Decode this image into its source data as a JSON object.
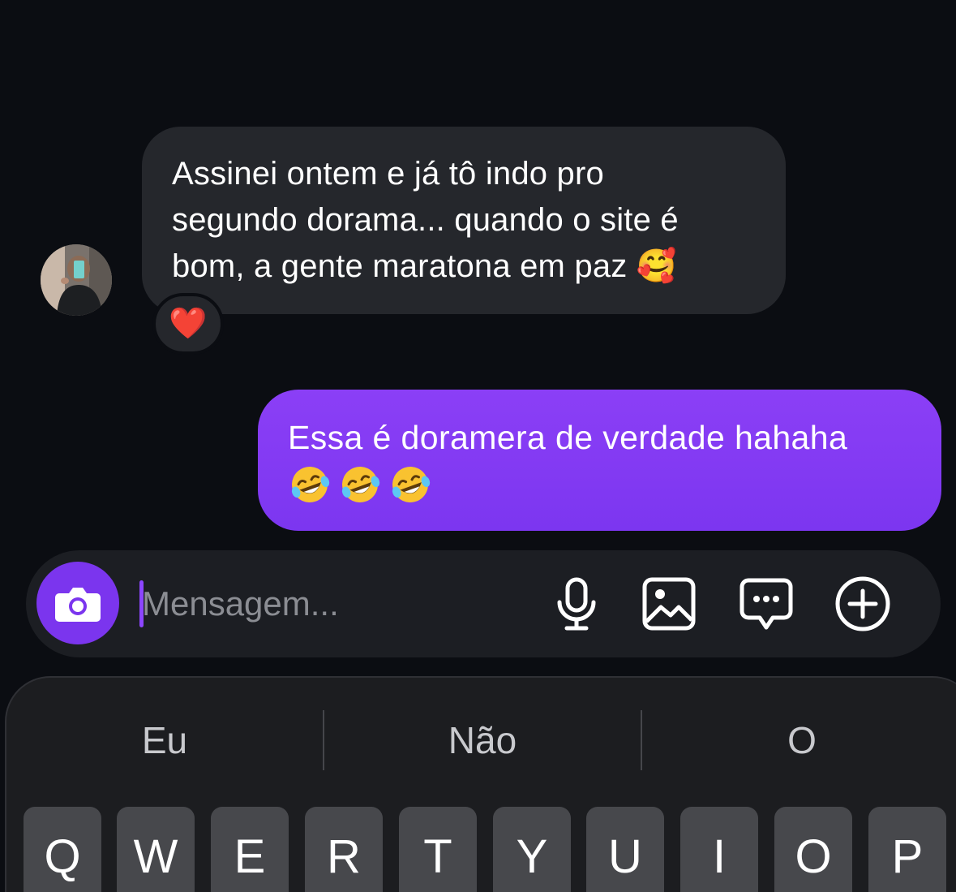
{
  "conversation": {
    "incoming": {
      "text": "Assinei ontem e já tô indo pro\nsegundo dorama... quando o site é\nbom, a gente maratona em paz 🥰",
      "reaction": "❤️"
    },
    "outgoing": {
      "text": "Essa é doramera de verdade hahaha",
      "emojis": [
        "🤣",
        "🤣",
        "🤣"
      ]
    }
  },
  "composer": {
    "placeholder": "Mensagem...",
    "value": "",
    "tools": [
      "microphone-icon",
      "image-icon",
      "chat-bubble-icon",
      "add-icon"
    ]
  },
  "keyboard": {
    "suggestions": [
      "Eu",
      "Não",
      "O"
    ],
    "keys": [
      "Q",
      "W",
      "E",
      "R",
      "T",
      "Y",
      "U",
      "I",
      "O",
      "P"
    ]
  },
  "colors": {
    "background": "#0b0d12",
    "incoming_bubble": "#25272c",
    "outgoing_bubble": "#7c36f0",
    "accent": "#7b35ee",
    "keyboard": "#1c1d20",
    "key": "#47484c"
  }
}
